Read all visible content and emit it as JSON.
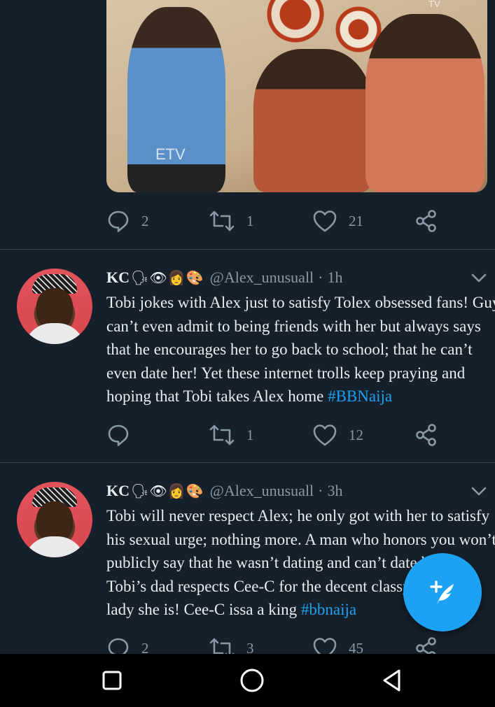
{
  "first_tweet": {
    "media": {
      "watermark_left": "ETV",
      "watermark_right": "TV"
    },
    "actions": {
      "reply_count": "2",
      "retweet_count": "1",
      "like_count": "21"
    }
  },
  "tweets": [
    {
      "name": "KC",
      "emojis": "🗣👁👩🎨",
      "handle": "@Alex_unusuall",
      "separator": "·",
      "time": "1h",
      "lines": [
        "Tobi jokes with Alex just to satisfy Tolex obsessed fans! Guy",
        "can’t even admit to being friends with her but always says",
        "that he encourages her to go back to school; that he can’t",
        "even date her! Yet these internet trolls keep praying and",
        "hoping that Tobi takes Alex home "
      ],
      "hashtag": "#BBNaija",
      "actions": {
        "reply_count": "",
        "retweet_count": "1",
        "like_count": "12"
      }
    },
    {
      "name": "KC",
      "emojis": "🗣👁👩🎨",
      "handle": "@Alex_unusuall",
      "separator": "·",
      "time": "3h",
      "lines": [
        "Tobi will never respect Alex; he only got with her to satisfy",
        "his sexual urge; nothing more. A man who honors you won’t",
        "publicly say that he wasn’t dating and can’t date he",
        "Tobi’s dad respects Cee-C for the decent classy i",
        "lady she is! Cee-C issa a king "
      ],
      "hashtag": "#bbnaija",
      "actions": {
        "reply_count": "2",
        "retweet_count": "3",
        "like_count": "45"
      }
    }
  ],
  "fab": {
    "icon": "compose-tweet-icon"
  },
  "navbar": {
    "icons": [
      "recent-apps-icon",
      "home-icon",
      "back-icon"
    ]
  },
  "colors": {
    "background": "#15202b",
    "accent": "#1da1f2",
    "muted": "#8899a6",
    "divider": "#38444d"
  }
}
